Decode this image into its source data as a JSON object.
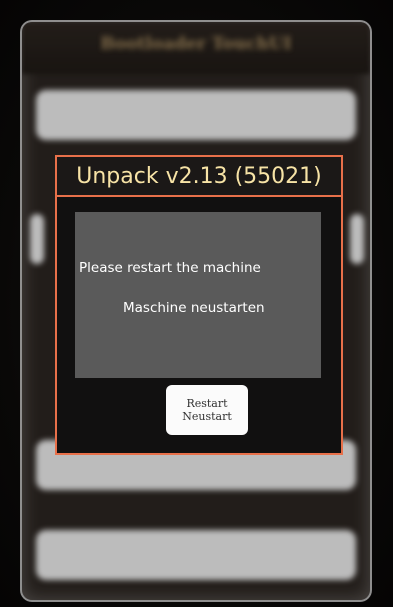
{
  "background": {
    "header_title": "Bootloader TouchUI"
  },
  "dialog": {
    "title": "Unpack v2.13 (55021)",
    "message_en": "Please restart the machine",
    "message_de": "Maschine neustarten",
    "restart_button": {
      "label_en": "Restart",
      "label_de": "Neustart"
    }
  },
  "colors": {
    "dialog_border": "#e8704a",
    "title_text": "#f7e3a6",
    "message_panel": "#5a5a5a"
  }
}
